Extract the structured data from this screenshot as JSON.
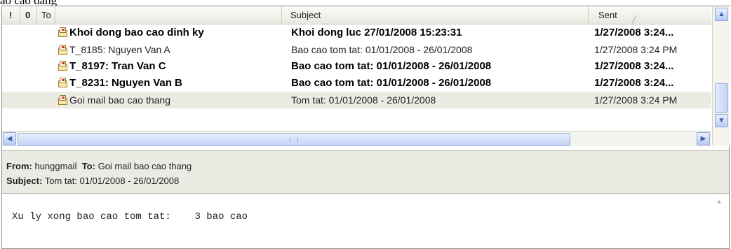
{
  "caption": "ao cao dang",
  "columns": {
    "importance": "!",
    "attachment": "0",
    "to": "To",
    "subject": "Subject",
    "sent": "Sent"
  },
  "messages": [
    {
      "to": "Khoi dong bao cao dinh ky",
      "subject": "Khoi dong luc 27/01/2008 15:23:31",
      "sent": "1/27/2008 3:24...",
      "unread": true
    },
    {
      "to": "T_8185: Nguyen Van A",
      "subject": "Bao cao tom tat: 01/01/2008 - 26/01/2008",
      "sent": "1/27/2008 3:24 PM",
      "unread": false
    },
    {
      "to": "T_8197: Tran Van C",
      "subject": "Bao cao tom tat: 01/01/2008 - 26/01/2008",
      "sent": "1/27/2008 3:24...",
      "unread": true
    },
    {
      "to": "T_8231: Nguyen Van B",
      "subject": "Bao cao tom tat: 01/01/2008 - 26/01/2008",
      "sent": "1/27/2008 3:24...",
      "unread": true
    },
    {
      "to": "Goi mail bao cao thang",
      "subject": "Tom tat: 01/01/2008 - 26/01/2008",
      "sent": "1/27/2008 3:24 PM",
      "unread": false,
      "selected": true
    }
  ],
  "preview": {
    "from_label": "From:",
    "from": "hunggmail",
    "to_label": "To:",
    "to": "Goi mail bao cao thang",
    "subject_label": "Subject:",
    "subject": "Tom tat: 01/01/2008 - 26/01/2008",
    "body": "Xu ly xong bao cao tom tat:    3 bao cao"
  },
  "icons": {
    "message": "mail-message-icon",
    "scroll_up": "scroll-up-icon",
    "scroll_down": "scroll-down-icon",
    "scroll_left": "scroll-left-icon",
    "scroll_right": "scroll-right-icon"
  }
}
